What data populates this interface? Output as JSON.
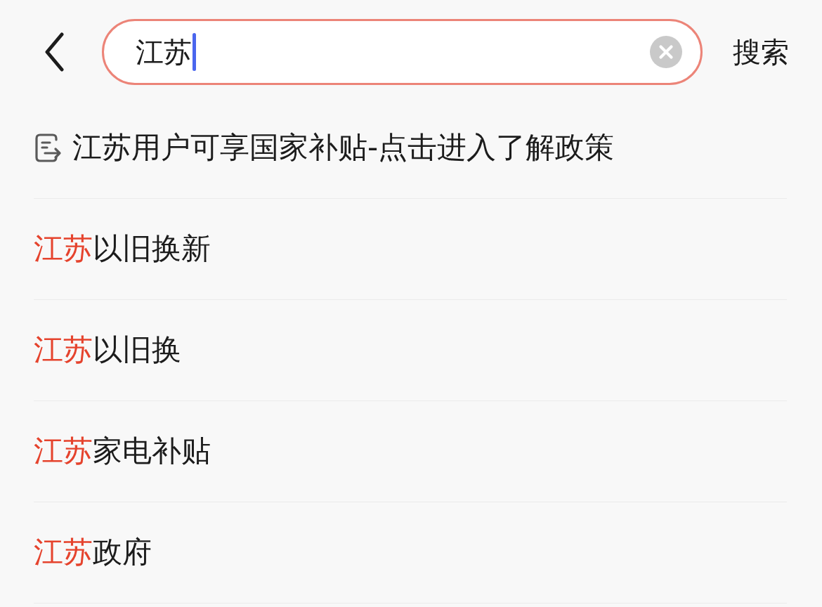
{
  "header": {
    "search": {
      "value": "江苏",
      "focused": true
    },
    "search_button": "搜索"
  },
  "suggestions": [
    {
      "kind": "policy",
      "text": "江苏用户可享国家补贴-点击进入了解政策"
    },
    {
      "kind": "query",
      "text": "**江苏**以旧换新"
    },
    {
      "kind": "query",
      "text": "**江苏**以旧换"
    },
    {
      "kind": "query",
      "text": "**江苏**家电补贴"
    },
    {
      "kind": "query",
      "text": "**江苏**政府"
    }
  ]
}
